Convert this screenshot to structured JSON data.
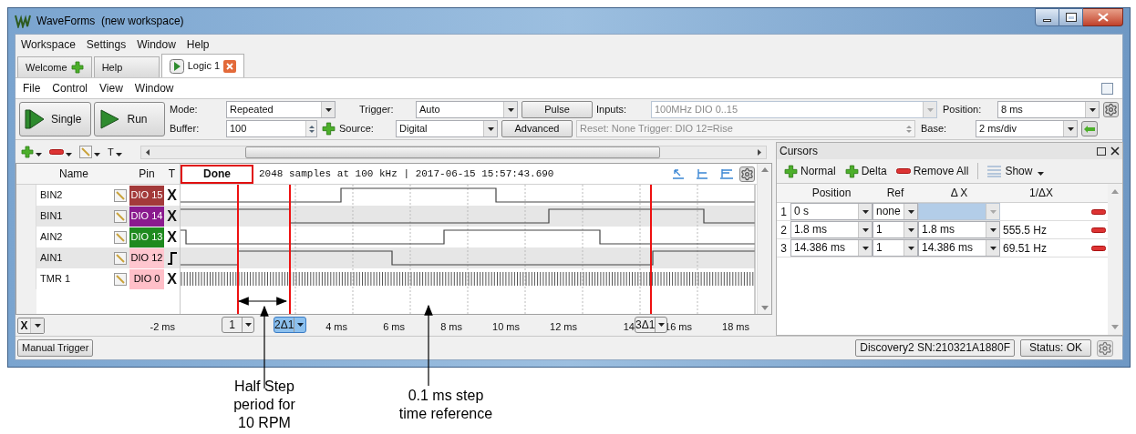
{
  "window": {
    "title": "WaveForms  (new workspace)"
  },
  "menu": [
    "Workspace",
    "Settings",
    "Window",
    "Help"
  ],
  "tabs": [
    {
      "label": "Welcome",
      "selected": false,
      "kind": "add"
    },
    {
      "label": "Help",
      "selected": false,
      "kind": "plain"
    },
    {
      "label": "Logic 1",
      "selected": true,
      "kind": "instrument"
    }
  ],
  "instrument_menu": [
    "File",
    "Control",
    "View",
    "Window"
  ],
  "acquisition": {
    "single": "Single",
    "run": "Run",
    "mode_label": "Mode:",
    "mode": "Repeated",
    "buffer_label": "Buffer:",
    "buffer": "100",
    "trigger_label": "Trigger:",
    "trigger": "Auto",
    "source_label": "Source:",
    "source": "Digital",
    "pulse": "Pulse",
    "advanced": "Advanced",
    "inputs_label": "Inputs:",
    "inputs": "100MHz DIO 0..15",
    "trigger_info": "Reset: None Trigger: DIO 12=Rise",
    "position_label": "Position:",
    "position": "8 ms",
    "base_label": "Base:",
    "base": "2 ms/div"
  },
  "signal_toolbar": {
    "type_menu": "T"
  },
  "signals": {
    "columns": [
      "Name",
      "Pin",
      "T"
    ],
    "status": "Done",
    "info": "2048 samples at 100 kHz | 2017-06-15 15:57:43.690",
    "rows": [
      {
        "name": "BIN2",
        "pin": "DIO 15",
        "color": "#a33a3a",
        "trigger": "X",
        "kind": "signal"
      },
      {
        "name": "BIN1",
        "pin": "DIO 14",
        "color": "#8a1a8e",
        "trigger": "X",
        "kind": "signal"
      },
      {
        "name": "AIN2",
        "pin": "DIO 13",
        "color": "#1f8a1f",
        "trigger": "X",
        "kind": "signal"
      },
      {
        "name": "AIN1",
        "pin": "DIO 12",
        "color": "#ffc6cf",
        "kind": "signal"
      },
      {
        "name": "TMR 1",
        "pin": "DIO 0",
        "color": "#ffbfc8",
        "trigger": "X",
        "kind": "clock"
      }
    ]
  },
  "axis": {
    "unit_menu": "X",
    "labels": [
      "-2 ms",
      "4 ms",
      "6 ms",
      "8 ms",
      "10 ms",
      "12 ms",
      "14",
      "16 ms",
      "18 ms"
    ],
    "cursor_tags": [
      {
        "label": "1",
        "selected": false
      },
      {
        "label": "2Δ1",
        "selected": true
      },
      {
        "label": "3Δ1",
        "selected": false
      }
    ]
  },
  "cursors": {
    "title": "Cursors",
    "actions": [
      "Normal",
      "Delta",
      "Remove All"
    ],
    "show": "Show",
    "columns": [
      "Position",
      "Ref",
      "Δ X",
      "1/ΔX"
    ],
    "rows": [
      {
        "index": "1",
        "position": "0 s",
        "ref": "none",
        "selected": true
      },
      {
        "index": "2",
        "position": "1.8 ms",
        "ref": "1",
        "delta": "1.8 ms",
        "inverse": "555.5 Hz",
        "selected": false
      },
      {
        "index": "3",
        "position": "14.386 ms",
        "ref": "1",
        "delta": "14.386 ms",
        "inverse": "69.51 Hz",
        "selected": false
      }
    ]
  },
  "status_bar": {
    "manual_trigger": "Manual Trigger",
    "device": "Discovery2 SN:210321A1880F",
    "status": "Status: OK"
  },
  "annotations": [
    {
      "text": "Half Step period for 10 RPM"
    },
    {
      "text": "0.1 ms step time reference"
    }
  ]
}
